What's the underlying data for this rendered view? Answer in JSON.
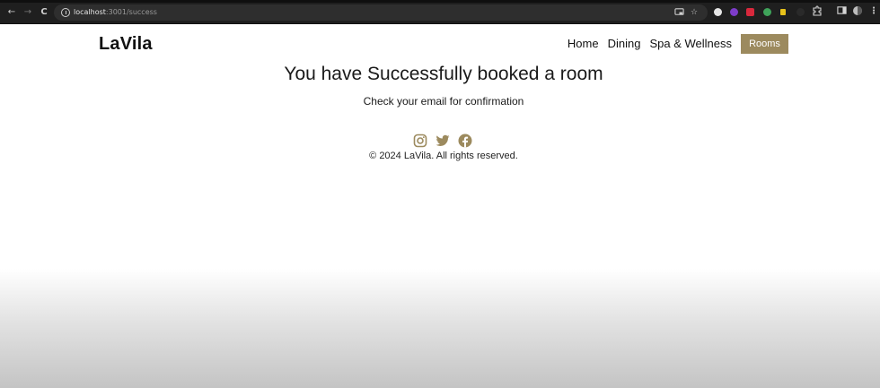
{
  "browser": {
    "url_host": "localhost",
    "url_path": ":3001/success",
    "back_glyph": "←",
    "forward_glyph": "→",
    "reload_glyph": "C",
    "star_glyph": "☆",
    "extension_colors": [
      "#e6e6e6",
      "#7d3cc9",
      "#d8283c",
      "#3fa35a",
      "#e8c21a"
    ]
  },
  "site": {
    "logo": "LaVila",
    "nav": {
      "home": "Home",
      "dining": "Dining",
      "spa": "Spa & Wellness",
      "rooms": "Rooms"
    },
    "accent_color": "#9c8a5e"
  },
  "main": {
    "headline": "You have Successfully booked a room",
    "subline": "Check your email for confirmation"
  },
  "footer": {
    "social_icons": [
      "instagram-icon",
      "twitter-icon",
      "facebook-icon"
    ],
    "copyright": "© 2024 LaVila. All rights reserved."
  }
}
